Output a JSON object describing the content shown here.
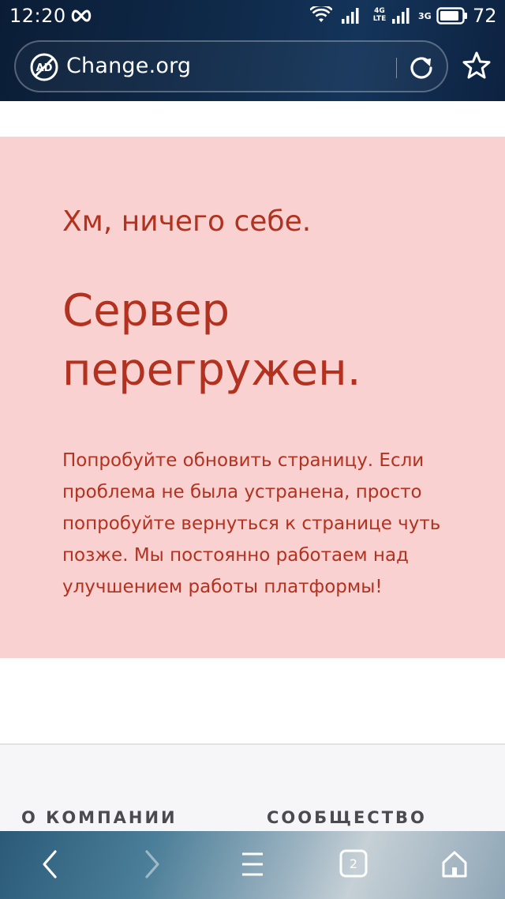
{
  "status_bar": {
    "time": "12:20",
    "network_4g": "4G",
    "network_lte": "LTE",
    "network_3g": "3G",
    "battery": "72",
    "icons": [
      "infinity-icon",
      "wifi-icon",
      "signal-icon",
      "battery-icon"
    ]
  },
  "browser": {
    "url": "Change.org",
    "icons": [
      "adblock-icon",
      "reload-icon",
      "star-icon"
    ]
  },
  "error": {
    "title_small": "Хм, ничего себе.",
    "title_big": "Сервер перегружен.",
    "message": "Попробуйте обновить страницу. Если проблема не была устранена, просто попробуйте вернуться к странице чуть позже. Мы постоянно работаем над улучшением работы платформы!"
  },
  "footer": {
    "col1": "О КОМПАНИИ",
    "col2": "СООБЩЕСТВО"
  },
  "bottom_nav": {
    "tabs_count": "2",
    "icons": [
      "back-icon",
      "forward-icon",
      "menu-icon",
      "tabs-icon",
      "home-icon"
    ]
  },
  "colors": {
    "error_bg": "#f9d1d1",
    "error_text": "#b3321f",
    "header_bg": "#0f2a4a"
  }
}
